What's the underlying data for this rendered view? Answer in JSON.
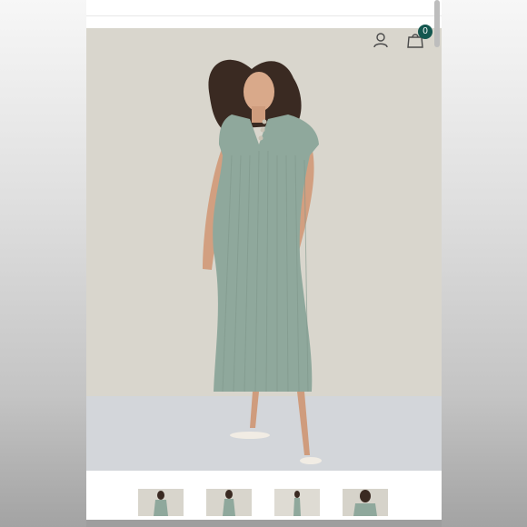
{
  "header": {
    "account_icon": "user-icon",
    "cart_icon": "shopping-bag-icon",
    "cart_count": "0"
  },
  "product": {
    "main_image": "model-in-sage-ribbed-midi-dress",
    "thumbnails": [
      "thumbnail-front-view",
      "thumbnail-full-view",
      "thumbnail-side-view",
      "thumbnail-closeup-view"
    ]
  },
  "colors": {
    "accent": "#14574f",
    "dress": "#8fa89c",
    "background": "#d9d6cd",
    "floor": "#d3d6da"
  }
}
